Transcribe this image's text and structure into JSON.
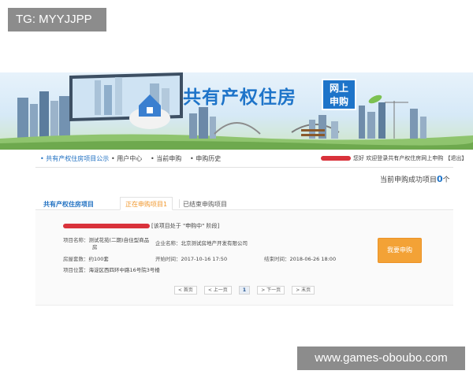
{
  "watermark": {
    "top": "TG: MYYJJPP",
    "bottom": "www.games-oboubo.com"
  },
  "banner": {
    "title": "共有产权住房",
    "tag_line1": "网上",
    "tag_line2": "申购",
    "icon": "house-in-hands-icon"
  },
  "nav": {
    "items": [
      "• 共有产权住房项目公示",
      "• 用户中心",
      "• 当前申购",
      "• 申购历史"
    ],
    "user_text": "您好 欢迎登录共有产权住房网上申购 【退出】"
  },
  "status": {
    "label": "当前申购成功项目",
    "count": "0",
    "unit": "个"
  },
  "tabs": [
    "共有产权住房项目",
    "正在申购项目1",
    "已结束申购项目"
  ],
  "project": {
    "stage": "[该项目处于 \"申购中\" 阶段]",
    "name_label": "项目名称：",
    "name_value_line1": "测试花苑(二期)自住型商品",
    "name_value_line2": "房",
    "company_label": "企业名称：",
    "company_value": "北京测试房地产开发有限公司",
    "units_label": "房屋套数：",
    "units_value": "约100套",
    "start_label": "开始时间：",
    "start_value": "2017-10-16 17:50",
    "end_label": "结束时间：",
    "end_value": "2018-06-26 18:00",
    "location_label": "项目位置：",
    "location_value": "海淀区西四环中路16号院3号楼",
    "apply_button": "我要申购"
  },
  "pager": {
    "first": "< 首页",
    "prev": "< 上一页",
    "current": "1",
    "next": "> 下一页",
    "last": "> 末页"
  },
  "colors": {
    "brand_blue": "#1e74c9",
    "tab_active": "#f0962a",
    "apply_button": "#f3a236",
    "redaction": "#d9323b"
  }
}
